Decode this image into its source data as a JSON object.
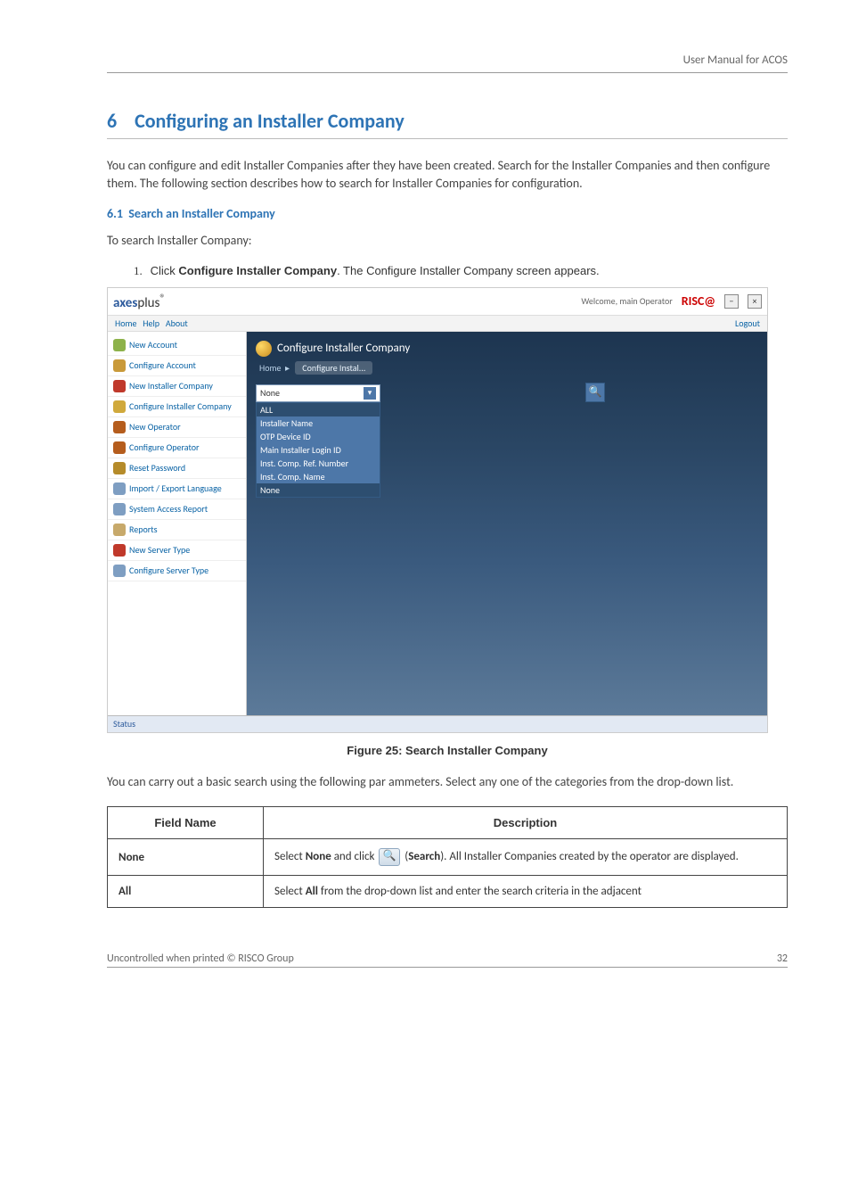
{
  "header": {
    "right": "User Manual for ACOS"
  },
  "section": {
    "number": "6",
    "title": "Configuring an Installer Company",
    "intro": "You can configure and edit Installer Companies after they have been created. Search for the Installer Companies and then configure them. The following section describes how to search for Installer Companies for configuration."
  },
  "sub": {
    "number": "6.1",
    "title": "Search an Installer Company",
    "lead": "To search Installer Company:"
  },
  "step": {
    "num": "1.",
    "pre": "Click ",
    "bold": "Configure Installer Company",
    "post": ". The Configure Installer Company screen appears."
  },
  "screenshot": {
    "brand_a": "axes",
    "brand_b": "plus",
    "brand_sup": "®",
    "welcome": "Welcome, main   Operator",
    "risc": "RISC@",
    "minimize": "−",
    "close": "×",
    "menu": {
      "home": "Home",
      "help": "Help",
      "about": "About",
      "logout": "Logout"
    },
    "sidebar": [
      {
        "label": "New Account",
        "icon": "#8db24a"
      },
      {
        "label": "Configure Account",
        "icon": "#c99a3a"
      },
      {
        "label": "New Installer Company",
        "icon": "#c0392b"
      },
      {
        "label": "Configure Installer Company",
        "icon": "#d0a93c"
      },
      {
        "label": "New Operator",
        "icon": "#b55d1d"
      },
      {
        "label": "Configure Operator",
        "icon": "#b55d1d"
      },
      {
        "label": "Reset Password",
        "icon": "#b58b2a"
      },
      {
        "label": "Import / Export Language",
        "icon": "#7e9ec2"
      },
      {
        "label": "System Access Report",
        "icon": "#7e9ec2"
      },
      {
        "label": "Reports",
        "icon": "#c7a96b"
      },
      {
        "label": "New Server Type",
        "icon": "#c0392b"
      },
      {
        "label": "Configure Server Type",
        "icon": "#7e9ec2"
      }
    ],
    "panel_title": "Configure Installer Company",
    "tab_home": "Home",
    "tab_conf": "Configure Instal...",
    "dd_selected": "None",
    "dd_options": [
      "ALL",
      "Installer Name",
      "OTP Device ID",
      "Main Installer Login ID",
      "Inst. Comp. Ref. Number",
      "Inst. Comp. Name",
      "None"
    ],
    "status": "Status"
  },
  "figure_caption": "Figure 25: Search Installer Company",
  "after_figure": "You can carry out a basic search using the following par ammeters. Select any one of the categories from the drop-down list.",
  "table": {
    "head_field": "Field Name",
    "head_desc": "Description",
    "rows": [
      {
        "field": "None",
        "desc_pre": "Select ",
        "desc_b1": "None",
        "desc_mid": " and click ",
        "desc_paren_open": " (",
        "desc_b2": "Search",
        "desc_post": "). All Installer Companies created by the operator are displayed."
      },
      {
        "field": "All",
        "desc_pre": "Select ",
        "desc_b1": "All",
        "desc_post": " from the drop-down list and enter the search criteria in the adjacent"
      }
    ]
  },
  "footer": {
    "left": "Uncontrolled when printed © RISCO Group",
    "right": "32"
  }
}
